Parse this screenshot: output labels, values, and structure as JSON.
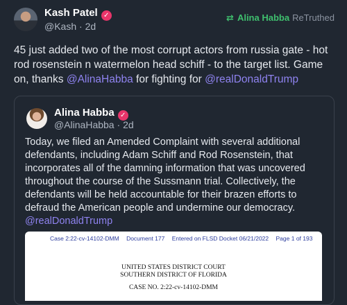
{
  "post": {
    "author_name": "Kash Patel",
    "author_handle": "@Kash",
    "time": "2d",
    "retruth_user": "Alina Habba",
    "retruth_label": "ReTruthed",
    "text_before": "45 just added two of the most corrupt actors from russia gate - hot rod rosenstein n watermelon head schiff - to the target list. Game on, thanks ",
    "mention1": "@AlinaHabba",
    "text_middle": " for fighting for ",
    "mention2": "@realDonaldTrump"
  },
  "quoted": {
    "author_name": "Alina Habba",
    "author_handle": "@AlinaHabba",
    "time": "2d",
    "text": "Today, we filed an Amended Complaint with several additional defendants, including Adam Schiff and Rod Rosenstein, that incorporates all of the damning information that was uncovered throughout the course of the Sussmann trial. Collectively, the defendants will be held accountable for their brazen efforts to defraud the American people and undermine our democracy. ",
    "mention": "@realDonaldTrump"
  },
  "document": {
    "case_header": "Case 2:22-cv-14102-DMM",
    "doc_number": "Document 177",
    "docket": "Entered on FLSD Docket 06/21/2022",
    "page": "Page 1 of 193",
    "court_line1": "UNITED STATES DISTRICT COURT",
    "court_line2": "SOUTHERN DISTRICT OF FLORIDA",
    "case_no": "CASE NO. 2:22-cv-14102-DMM"
  },
  "colors": {
    "background": "#202731",
    "mention": "#8f83f0",
    "retruth": "#3fbf6e",
    "verified_badge": "#e8356a"
  }
}
